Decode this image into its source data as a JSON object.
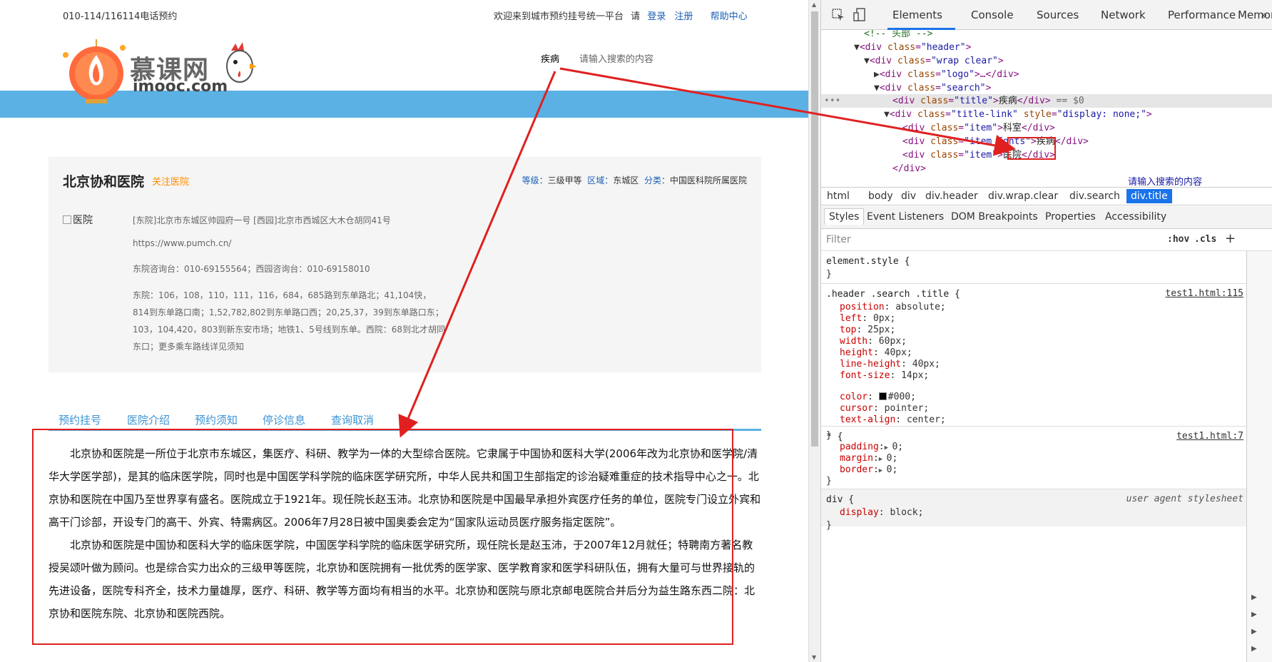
{
  "page": {
    "phone": "010-114/116114电话预约",
    "welcome": "欢迎来到城市预约挂号统一平台",
    "please": "请",
    "login": "登录",
    "register": "注册",
    "help": "帮助中心",
    "logo_cn": "慕课网",
    "logo_en": "imooc.com",
    "search_title": "疾病",
    "search_placeholder": "请输入搜索的内容",
    "hospital": {
      "name": "北京协和医院",
      "follow": "关注医院",
      "level_label": "等级：",
      "level": "三级甲等",
      "area_label": "区域：",
      "area": "东城区",
      "category_label": "分类：",
      "category": "中国医科院所属医院",
      "image_alt": "医院",
      "address": "[东院]北京市东城区帅园府一号 [西园]北京市西城区大木仓胡同41号",
      "website": "https://www.pumch.cn/",
      "phones": "东院咨询台：010-69155564；西园咨询台：010-69158010",
      "transport": "东院：106，108，110，111，116，684，685路到东单路北；41,104快，814到东单路口南；1,52,782,802到东单路口西；20,25,37，39到东单路口东；103，104,420，803到新东安市场；地铁1、5号线到东单。西院：68到北才胡同东口；更多乘车路线详见须知"
    },
    "tabs": [
      "预约挂号",
      "医院介绍",
      "预约须知",
      "停诊信息",
      "查询取消"
    ],
    "paragraphs": [
      "北京协和医院是一所位于北京市东城区，集医疗、科研、教学为一体的大型综合医院。它隶属于中国协和医科大学(2006年改为北京协和医学院/清华大学医学部)，是其的临床医学院，同时也是中国医学科学院的临床医学研究所，中华人民共和国卫生部指定的诊治疑难重症的技术指导中心之一。北京协和医院在中国乃至世界享有盛名。医院成立于1921年。现任院长赵玉沛。北京协和医院是中国最早承担外宾医疗任务的单位，医院专门设立外宾和高干门诊部，开设专门的高干、外宾、特需病区。2006年7月28日被中国奥委会定为“国家队运动员医疗服务指定医院”。",
      "北京协和医院是中国协和医科大学的临床医学院，中国医学科学院的临床医学研究所，现任院长是赵玉沛，于2007年12月就任；特聘南方著名教授吴颂叶做为顾问。也是综合实力出众的三级甲等医院，北京协和医院拥有一批优秀的医学家、医学教育家和医学科研队伍，拥有大量可与世界接轨的先进设备，医院专科齐全，技术力量雄厚，医疗、科研、教学等方面均有相当的水平。北京协和医院与原北京邮电医院合并后分为益生路东西二院：北京协和医院东院、北京协和医院西院。"
    ]
  },
  "devtools": {
    "tabs": [
      "Elements",
      "Console",
      "Sources",
      "Network",
      "Performance",
      "Memory"
    ],
    "more": "»",
    "dom": {
      "comment": "<!-- 头部 -->",
      "header_cls": "header",
      "wrap_cls": "wrap clear",
      "logo_cls": "logo",
      "search_cls": "search",
      "title_cls": "title",
      "title_text": "疾病",
      "selected_suffix": " == $0",
      "titlelink_cls": "title-link",
      "titlelink_style": "display: none;",
      "item_cls": "item",
      "item1_text": "科室",
      "item2_cls": "item fonts",
      "item2_text": "疾病",
      "item3_text": "医院",
      "next_partial": "请输入搜索的内容"
    },
    "breadcrumbs": [
      "html",
      "body",
      "div",
      "div.header",
      "div.wrap.clear",
      "div.search",
      "div.title"
    ],
    "subtabs": [
      "Styles",
      "Event Listeners",
      "DOM Breakpoints",
      "Properties",
      "Accessibility"
    ],
    "filter_placeholder": "Filter",
    "hov": ":hov",
    "cls": ".cls",
    "plus": "+",
    "styles": {
      "element_style": "element.style {",
      "close": "}",
      "rule1_selector": ".header .search .title {",
      "rule1_source": "test1.html:115",
      "rule1_props": [
        [
          "position",
          "absolute;"
        ],
        [
          "left",
          "0px;"
        ],
        [
          "top",
          "25px;"
        ],
        [
          "width",
          "60px;"
        ],
        [
          "height",
          "40px;"
        ],
        [
          "line-height",
          "40px;"
        ],
        [
          "font-size",
          "14px;"
        ]
      ],
      "color_prop": "color",
      "color_val": "#000;",
      "rule1_props2": [
        [
          "cursor",
          "pointer;"
        ],
        [
          "text-align",
          "center;"
        ]
      ],
      "rule2_selector": "* {",
      "rule2_source": "test1.html:7",
      "rule2_props": [
        [
          "padding",
          "0;"
        ],
        [
          "margin",
          "0;"
        ],
        [
          "border",
          "0;"
        ]
      ],
      "rule3_selector": "div {",
      "rule3_source": "user agent stylesheet",
      "rule3_props": [
        [
          "display",
          "block;"
        ]
      ]
    }
  },
  "colors": {
    "annotation": "#e02020",
    "band": "#5bb1e3",
    "link": "#1a5fb4",
    "follow": "#ff8a00",
    "tab_text": "#3a93d4"
  }
}
